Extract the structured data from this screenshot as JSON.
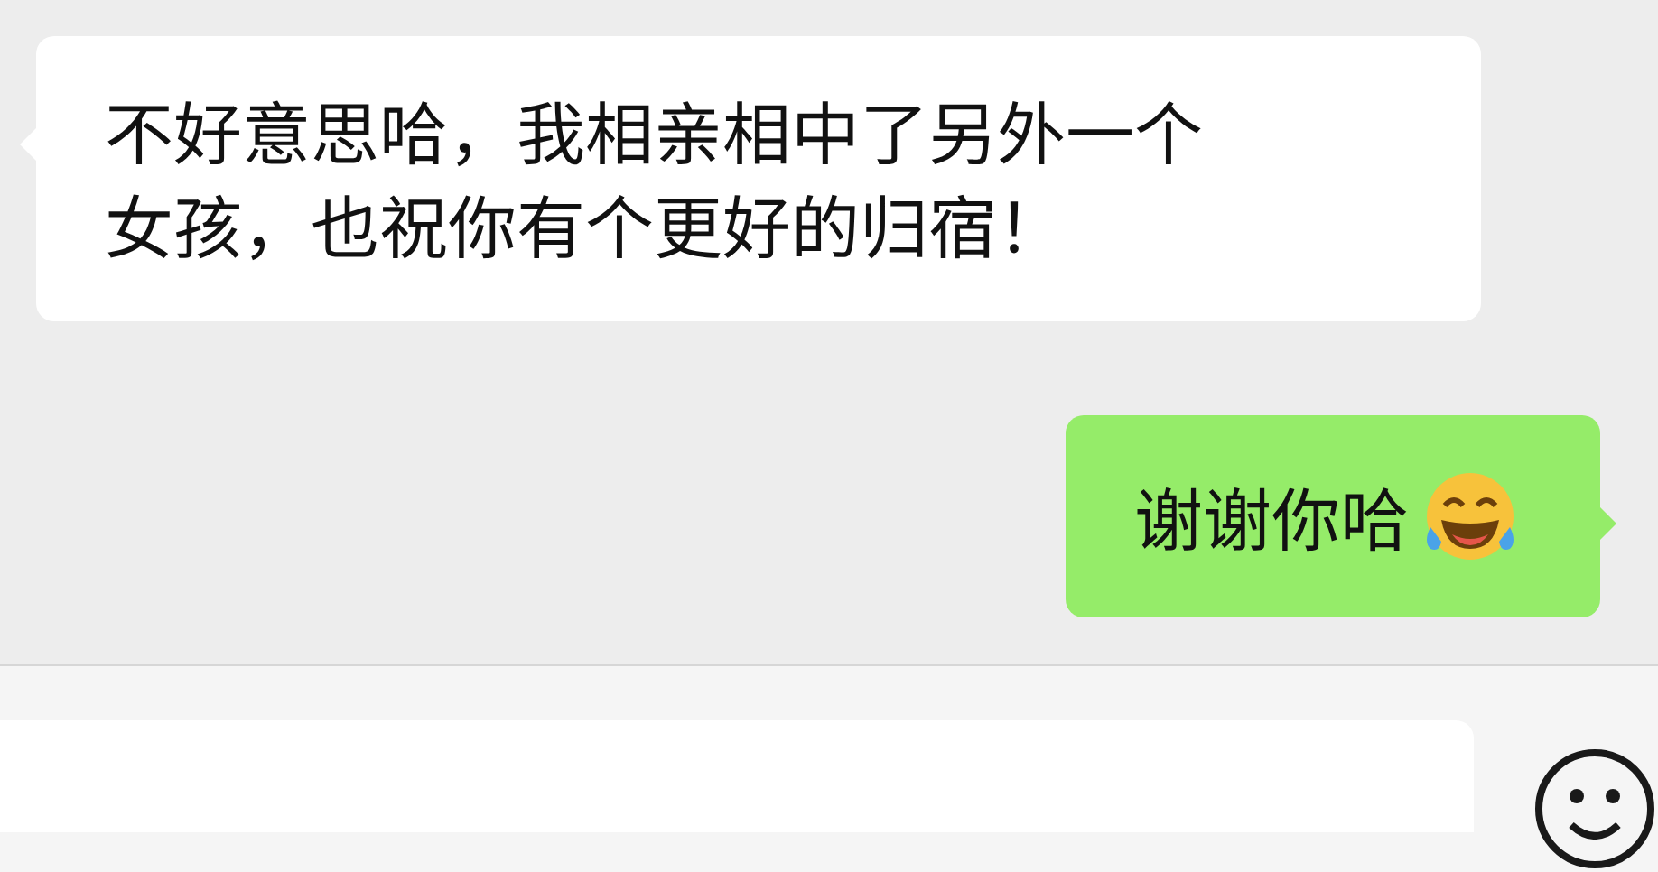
{
  "messages": [
    {
      "kind": "incoming",
      "text": "不好意思哈，我相亲相中了另外一个女孩，也祝你有个更好的归宿！",
      "emoji": false
    },
    {
      "kind": "outgoing",
      "text": "谢谢你哈",
      "emoji": true
    }
  ]
}
